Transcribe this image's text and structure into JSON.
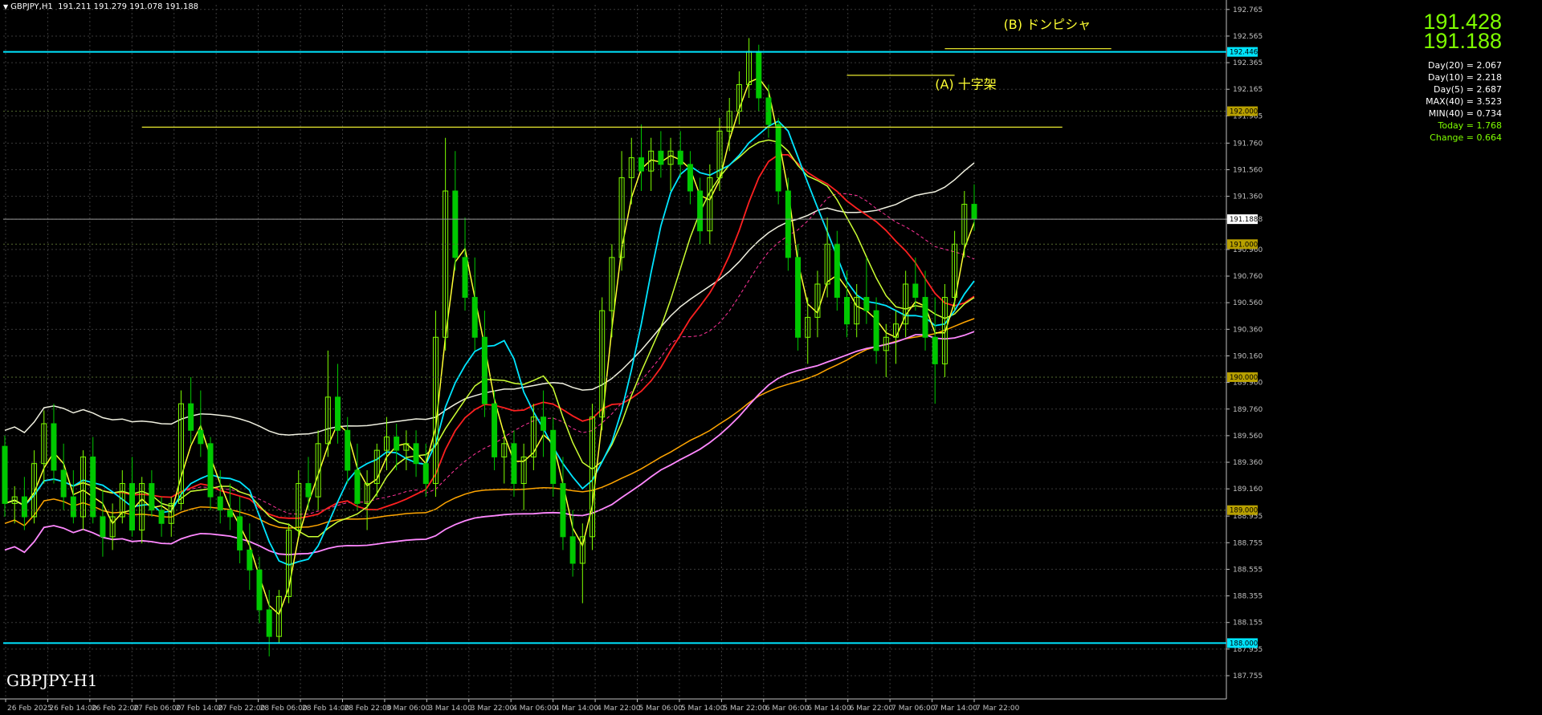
{
  "header": {
    "symbol_tf": "GBPJPY,H1",
    "ohlc": "191.211 191.279 191.078 191.188"
  },
  "symbol_label": "GBPJPY-H1",
  "prices": {
    "bid": "191.428",
    "ask": "191.188"
  },
  "stats": [
    {
      "text": "Day(20) = 2.067",
      "color": "#ffffff"
    },
    {
      "text": "Day(10) = 2.218",
      "color": "#ffffff"
    },
    {
      "text": "Day(5) = 2.687",
      "color": "#ffffff"
    },
    {
      "text": "MAX(40) = 3.523",
      "color": "#ffffff"
    },
    {
      "text": "MIN(40) = 0.734",
      "color": "#ffffff"
    },
    {
      "text": "Today = 1.768",
      "color": "#7fff00"
    },
    {
      "text": "Change = 0.664",
      "color": "#7fff00"
    }
  ],
  "colors": {
    "bull": "#7fff00",
    "bear": "#00c800",
    "grid": "#3a3a3a",
    "axis": "#c0c0c0",
    "cyan": "#00e5ff",
    "yellow": "#ffff33",
    "red": "#ff2020",
    "orange": "#ffa500",
    "pink": "#ff88ff",
    "magenta": "#ff3399",
    "white": "#f0f0e0",
    "lime": "#ccff33"
  },
  "chart_data": {
    "type": "candlestick",
    "symbol": "GBPJPY",
    "timeframe": "H1",
    "ylim": [
      187.58,
      192.8
    ],
    "y_ticks": [
      "192.765",
      "192.565",
      "192.365",
      "192.165",
      "191.965",
      "191.760",
      "191.560",
      "191.360",
      "191.188",
      "190.960",
      "190.760",
      "190.560",
      "190.360",
      "190.160",
      "189.960",
      "189.760",
      "189.560",
      "189.360",
      "189.160",
      "188.955",
      "188.755",
      "188.555",
      "188.355",
      "188.155",
      "187.955",
      "187.755"
    ],
    "x_labels": [
      "26 Feb 2025",
      "26 Feb 14:00",
      "26 Feb 22:00",
      "27 Feb 06:00",
      "27 Feb 14:00",
      "27 Feb 22:00",
      "28 Feb 06:00",
      "28 Feb 14:00",
      "28 Feb 22:00",
      "3 Mar 06:00",
      "3 Mar 14:00",
      "3 Mar 22:00",
      "4 Mar 06:00",
      "4 Mar 14:00",
      "4 Mar 22:00",
      "5 Mar 06:00",
      "5 Mar 14:00",
      "5 Mar 22:00",
      "6 Mar 06:00",
      "6 Mar 14:00",
      "6 Mar 22:00",
      "7 Mar 06:00",
      "7 Mar 14:00",
      "7 Mar 22:00"
    ],
    "price_tags": [
      {
        "value": 192.446,
        "label": "192.446",
        "type": "cyan-line"
      },
      {
        "value": 192.0,
        "label": "192.000",
        "type": "level"
      },
      {
        "value": 191.188,
        "label": "191.188",
        "type": "current"
      },
      {
        "value": 191.0,
        "label": "191.000",
        "type": "level"
      },
      {
        "value": 190.0,
        "label": "190.000",
        "type": "level"
      },
      {
        "value": 189.0,
        "label": "189.000",
        "type": "level"
      },
      {
        "value": 188.0,
        "label": "188.000",
        "type": "cyan-line"
      }
    ],
    "annotations": [
      {
        "text": "(B)  ドンピシャ",
        "x": 102,
        "price": 192.62
      },
      {
        "text": "(A)  十字架",
        "x": 95,
        "price": 192.17
      }
    ],
    "horizontal_segments": [
      {
        "price": 191.88,
        "x_from": 14,
        "x_to": 108,
        "color": "#ffff33"
      },
      {
        "price": 192.27,
        "x_from": 86,
        "x_to": 97,
        "color": "#ffff33"
      },
      {
        "price": 192.47,
        "x_from": 96,
        "x_to": 113,
        "color": "#ffff33"
      }
    ],
    "candles_ohlc": [
      [
        189.48,
        189.56,
        188.95,
        189.05
      ],
      [
        189.05,
        189.18,
        188.9,
        189.1
      ],
      [
        189.1,
        189.25,
        188.85,
        188.95
      ],
      [
        188.95,
        189.45,
        188.9,
        189.35
      ],
      [
        189.35,
        189.75,
        189.2,
        189.65
      ],
      [
        189.65,
        189.8,
        189.2,
        189.3
      ],
      [
        189.3,
        189.5,
        189.0,
        189.1
      ],
      [
        189.1,
        189.3,
        188.9,
        188.95
      ],
      [
        188.95,
        189.45,
        188.85,
        189.4
      ],
      [
        189.4,
        189.55,
        188.9,
        188.95
      ],
      [
        188.95,
        189.15,
        188.65,
        188.8
      ],
      [
        188.8,
        189.05,
        188.7,
        188.95
      ],
      [
        188.95,
        189.3,
        188.9,
        189.2
      ],
      [
        189.2,
        189.4,
        188.8,
        188.85
      ],
      [
        188.85,
        189.25,
        188.75,
        189.2
      ],
      [
        189.2,
        189.3,
        188.95,
        189.0
      ],
      [
        189.0,
        189.1,
        188.8,
        188.9
      ],
      [
        188.9,
        189.1,
        188.8,
        189.05
      ],
      [
        189.05,
        189.9,
        189.0,
        189.8
      ],
      [
        189.8,
        190.0,
        189.5,
        189.6
      ],
      [
        189.6,
        189.9,
        189.4,
        189.5
      ],
      [
        189.5,
        189.55,
        189.0,
        189.1
      ],
      [
        189.1,
        189.3,
        188.9,
        189.0
      ],
      [
        189.0,
        189.2,
        188.85,
        188.95
      ],
      [
        188.95,
        189.1,
        188.6,
        188.7
      ],
      [
        188.7,
        188.9,
        188.4,
        188.55
      ],
      [
        188.55,
        188.65,
        188.15,
        188.25
      ],
      [
        188.25,
        188.4,
        187.9,
        188.05
      ],
      [
        188.05,
        188.4,
        188.0,
        188.35
      ],
      [
        188.35,
        188.9,
        188.3,
        188.85
      ],
      [
        188.85,
        189.3,
        188.8,
        189.2
      ],
      [
        189.2,
        189.4,
        189.0,
        189.1
      ],
      [
        189.1,
        189.6,
        189.0,
        189.5
      ],
      [
        189.5,
        190.2,
        189.4,
        189.85
      ],
      [
        189.85,
        190.1,
        189.5,
        189.6
      ],
      [
        189.6,
        189.7,
        189.2,
        189.3
      ],
      [
        189.3,
        189.5,
        189.0,
        189.05
      ],
      [
        189.05,
        189.3,
        188.85,
        189.2
      ],
      [
        189.2,
        189.5,
        189.1,
        189.45
      ],
      [
        189.45,
        189.7,
        189.3,
        189.55
      ],
      [
        189.55,
        189.65,
        189.3,
        189.45
      ],
      [
        189.45,
        189.6,
        189.3,
        189.5
      ],
      [
        189.5,
        189.6,
        189.25,
        189.35
      ],
      [
        189.35,
        189.5,
        189.1,
        189.2
      ],
      [
        189.2,
        190.5,
        189.1,
        190.3
      ],
      [
        190.3,
        191.8,
        190.2,
        191.4
      ],
      [
        191.4,
        191.7,
        190.8,
        190.9
      ],
      [
        190.9,
        191.2,
        190.5,
        190.6
      ],
      [
        190.6,
        190.9,
        190.2,
        190.3
      ],
      [
        190.3,
        190.5,
        189.7,
        189.8
      ],
      [
        189.8,
        189.9,
        189.3,
        189.4
      ],
      [
        189.4,
        189.6,
        189.2,
        189.5
      ],
      [
        189.5,
        189.6,
        189.1,
        189.2
      ],
      [
        189.2,
        189.5,
        189.0,
        189.4
      ],
      [
        189.4,
        189.8,
        189.3,
        189.7
      ],
      [
        189.7,
        189.9,
        189.4,
        189.6
      ],
      [
        189.6,
        189.7,
        189.1,
        189.2
      ],
      [
        189.2,
        189.4,
        188.7,
        188.8
      ],
      [
        188.8,
        189.0,
        188.5,
        188.6
      ],
      [
        188.6,
        188.9,
        188.3,
        188.8
      ],
      [
        188.8,
        189.8,
        188.7,
        189.7
      ],
      [
        189.7,
        190.6,
        189.6,
        190.5
      ],
      [
        190.5,
        191.0,
        190.3,
        190.9
      ],
      [
        190.9,
        191.7,
        190.8,
        191.5
      ],
      [
        191.5,
        191.8,
        191.3,
        191.65
      ],
      [
        191.65,
        191.9,
        191.4,
        191.55
      ],
      [
        191.55,
        191.8,
        191.4,
        191.7
      ],
      [
        191.7,
        191.85,
        191.5,
        191.6
      ],
      [
        191.6,
        191.8,
        191.4,
        191.7
      ],
      [
        191.7,
        191.85,
        191.5,
        191.6
      ],
      [
        191.6,
        191.7,
        191.3,
        191.4
      ],
      [
        191.4,
        191.5,
        191.0,
        191.1
      ],
      [
        191.1,
        191.6,
        191.0,
        191.5
      ],
      [
        191.5,
        191.95,
        191.4,
        191.85
      ],
      [
        191.85,
        192.1,
        191.7,
        192.0
      ],
      [
        192.0,
        192.3,
        191.9,
        192.2
      ],
      [
        192.2,
        192.55,
        192.1,
        192.45
      ],
      [
        192.45,
        192.5,
        192.0,
        192.1
      ],
      [
        192.1,
        192.2,
        191.8,
        191.9
      ],
      [
        191.9,
        191.95,
        191.3,
        191.4
      ],
      [
        191.4,
        191.5,
        190.8,
        190.9
      ],
      [
        190.9,
        191.0,
        190.2,
        190.3
      ],
      [
        190.3,
        190.6,
        190.1,
        190.45
      ],
      [
        190.45,
        190.8,
        190.3,
        190.7
      ],
      [
        190.7,
        191.2,
        190.6,
        191.0
      ],
      [
        191.0,
        191.1,
        190.5,
        190.6
      ],
      [
        190.6,
        190.8,
        190.3,
        190.4
      ],
      [
        190.4,
        190.7,
        190.3,
        190.6
      ],
      [
        190.6,
        190.9,
        190.4,
        190.5
      ],
      [
        190.5,
        190.6,
        190.1,
        190.2
      ],
      [
        190.2,
        190.4,
        190.0,
        190.3
      ],
      [
        190.3,
        190.5,
        190.1,
        190.4
      ],
      [
        190.4,
        190.8,
        190.3,
        190.7
      ],
      [
        190.7,
        190.9,
        190.5,
        190.6
      ],
      [
        190.6,
        190.8,
        190.2,
        190.3
      ],
      [
        190.3,
        190.6,
        189.8,
        190.1
      ],
      [
        190.1,
        190.7,
        190.0,
        190.6
      ],
      [
        190.6,
        191.1,
        190.5,
        191.0
      ],
      [
        191.0,
        191.4,
        190.9,
        191.3
      ],
      [
        191.3,
        191.45,
        191.1,
        191.19
      ]
    ]
  }
}
